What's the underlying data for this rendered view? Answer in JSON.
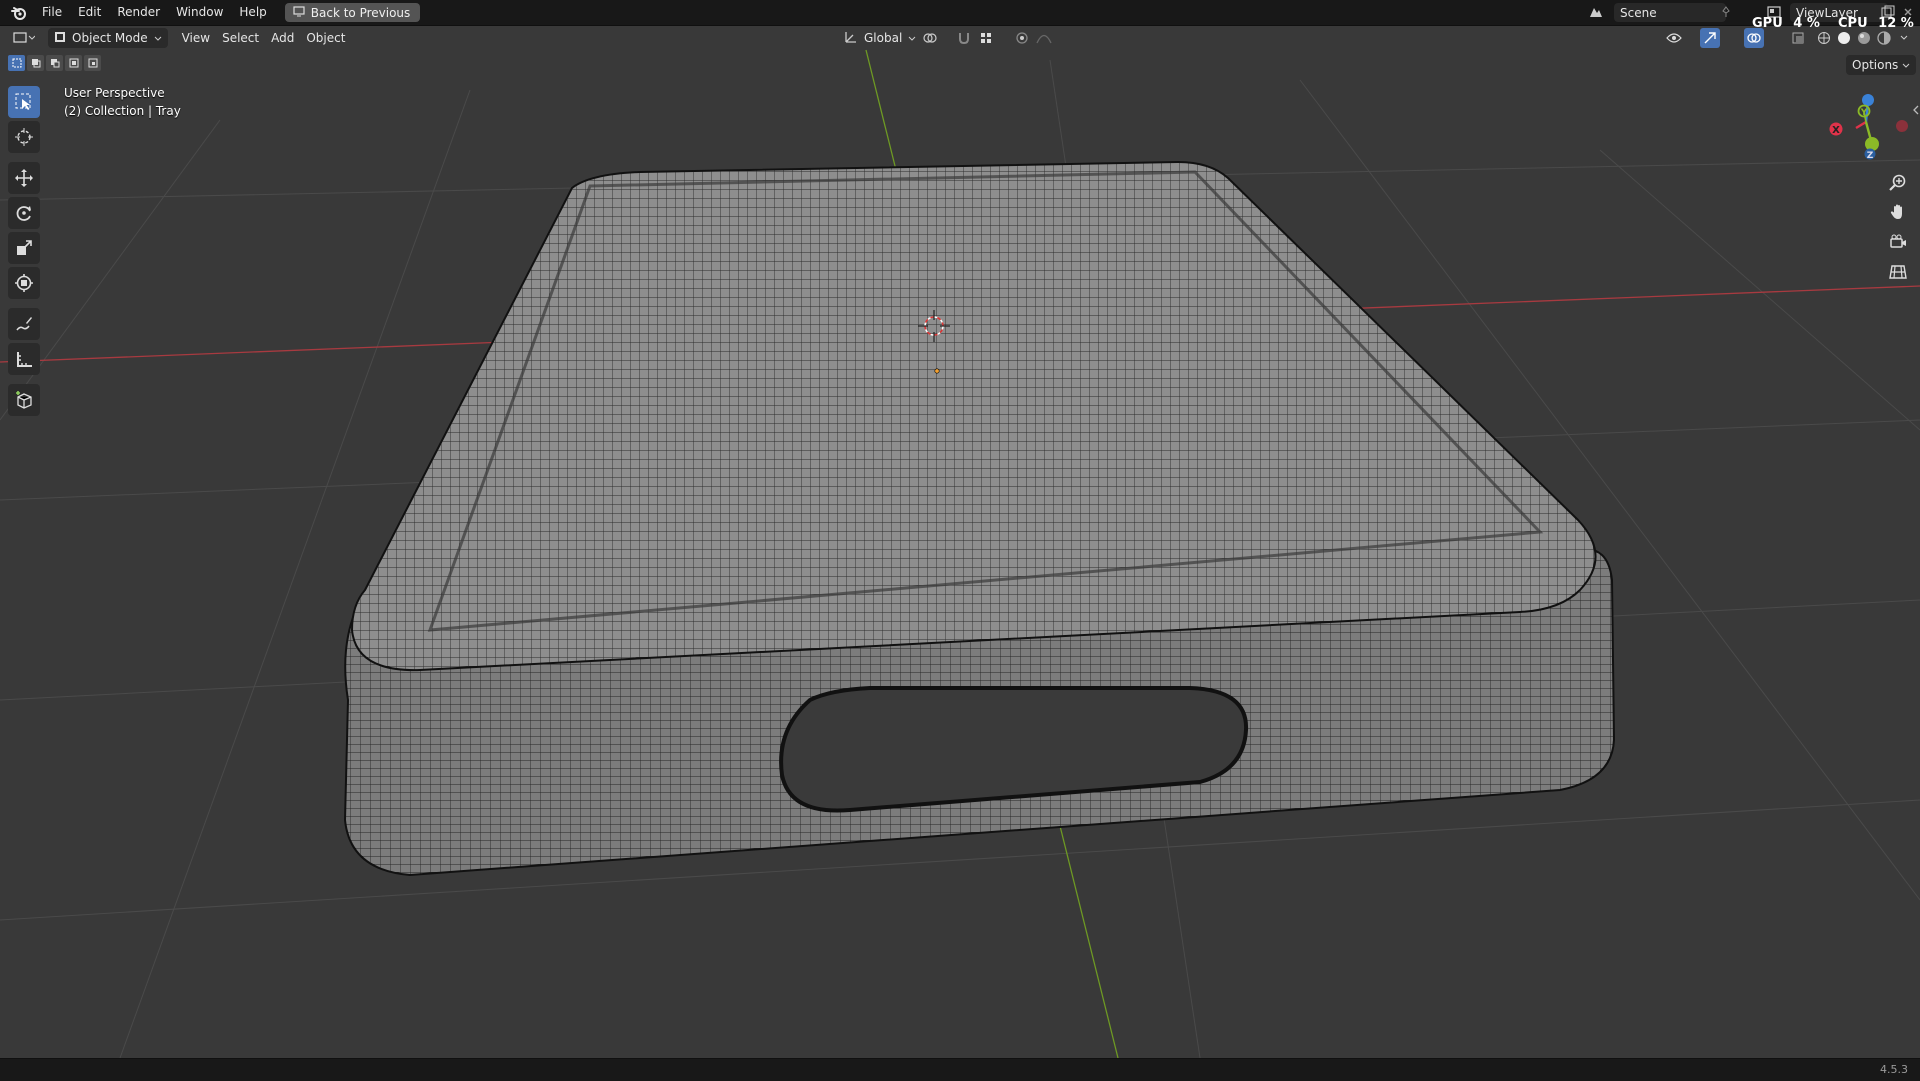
{
  "menu": {
    "items": [
      "File",
      "Edit",
      "Render",
      "Window",
      "Help"
    ],
    "back_button": "Back to Previous"
  },
  "top_right": {
    "scene_label": "Scene",
    "viewlayer_label": "ViewLayer",
    "gpu_label": "GPU",
    "gpu_value": "4 %",
    "cpu_label": "CPU",
    "cpu_value": "12 %"
  },
  "viewport_header": {
    "mode": "Object Mode",
    "menus": [
      "View",
      "Select",
      "Add",
      "Object"
    ],
    "orientation": "Global",
    "options": "Options"
  },
  "overlay": {
    "view_name": "User Perspective",
    "collection_info": "(2) Collection | Tray"
  },
  "gizmo": {
    "x_label": "X",
    "y_label": "Y",
    "z_label": "Z",
    "x_color": "#e0334a",
    "y_color": "#8bba27",
    "z_color": "#3a82d8"
  },
  "tools": [
    "select-box",
    "cursor",
    "move",
    "rotate",
    "scale",
    "transform",
    "annotate",
    "measure",
    "add-cube"
  ],
  "status": {
    "version": "4.5.3"
  },
  "colors": {
    "accent": "#4772b3",
    "background": "#393939",
    "bar": "#181818",
    "x_axis": "#b23a43",
    "y_axis": "#79a329"
  }
}
